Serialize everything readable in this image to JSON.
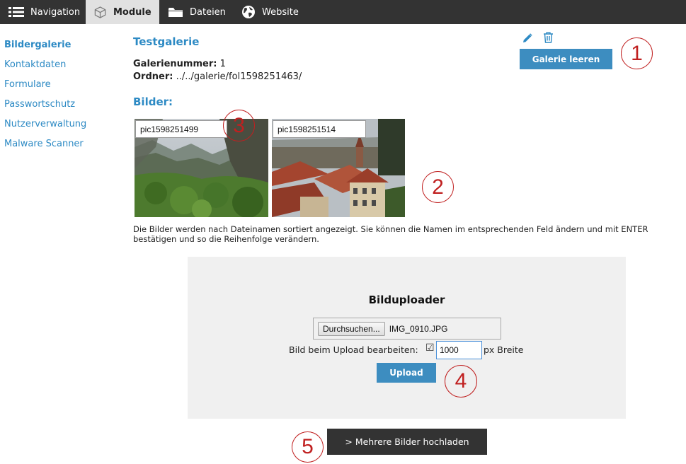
{
  "topbar": {
    "tabs": [
      {
        "label": "Navigation",
        "icon": "list-icon"
      },
      {
        "label": "Module",
        "icon": "cube-icon",
        "active": true
      },
      {
        "label": "Dateien",
        "icon": "folder-icon"
      },
      {
        "label": "Website",
        "icon": "globe-icon"
      }
    ]
  },
  "sidebar": {
    "items": [
      {
        "label": "Bildergalerie",
        "active": true
      },
      {
        "label": "Kontaktdaten"
      },
      {
        "label": "Formulare"
      },
      {
        "label": "Passwortschutz"
      },
      {
        "label": "Nutzerverwaltung"
      },
      {
        "label": "Malware Scanner"
      }
    ]
  },
  "gallery": {
    "title": "Testgalerie",
    "number_label": "Galerienummer:",
    "number_value": "1",
    "folder_label": "Ordner:",
    "folder_value": "../../galerie/fol1598251463/",
    "clear_button": "Galerie leeren",
    "images_heading": "Bilder:",
    "images": [
      {
        "name": "pic1598251499"
      },
      {
        "name": "pic1598251514"
      }
    ],
    "note": "Die Bilder werden nach Dateinamen sortiert angezeigt. Sie können die Namen im entsprechenden Feld ändern und mit ENTER bestätigen und so die Reihenfolge verändern."
  },
  "uploader": {
    "title": "Bilduploader",
    "browse_label": "Durchsuchen...",
    "file_name": "IMG_0910.JPG",
    "edit_label": "Bild beim Upload bearbeiten:",
    "checkbox_glyph": "☑",
    "width_value": "1000",
    "width_unit": "px Breite",
    "upload_button": "Upload"
  },
  "multi_upload_button": "> Mehrere Bilder hochladen",
  "callouts": [
    "1",
    "2",
    "3",
    "4",
    "5"
  ],
  "colors": {
    "topbar": "#333333",
    "accent_blue": "#2d8ac4",
    "button_blue": "#3d8dc0",
    "callout_red": "#c02020"
  }
}
